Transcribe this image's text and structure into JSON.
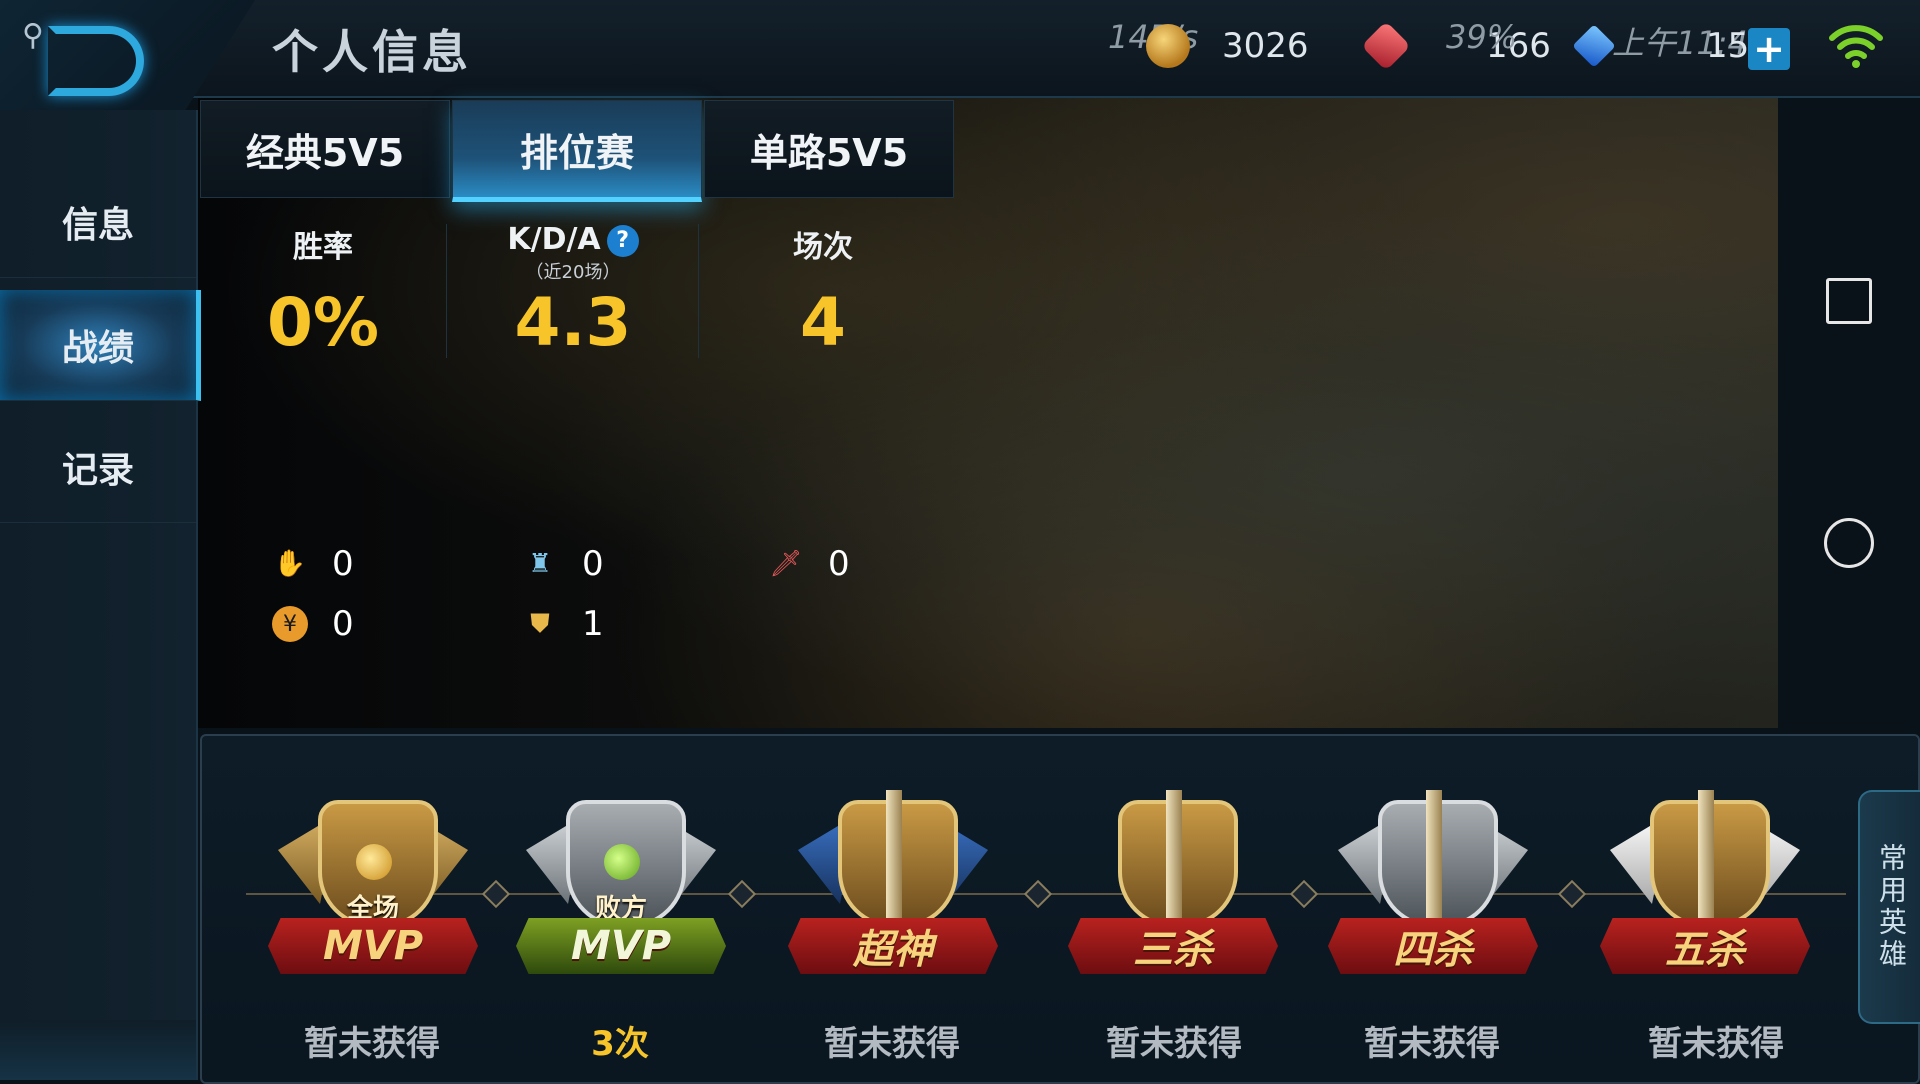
{
  "header": {
    "title": "个人信息",
    "speed": "14B/s",
    "coins": "3026",
    "gems": "166",
    "battery": "39%",
    "time": "上午11:43",
    "diamonds": "15"
  },
  "nav": {
    "items": [
      {
        "label": "信息"
      },
      {
        "label": "战绩"
      },
      {
        "label": "记录"
      }
    ]
  },
  "tabs": [
    "经典5V5",
    "排位赛",
    "单路5V5"
  ],
  "stats": {
    "win_rate": {
      "label": "胜率",
      "value": "0%"
    },
    "kda": {
      "label": "K/D/A",
      "sub": "（近20场）",
      "value": "4.3"
    },
    "games": {
      "label": "场次",
      "value": "4"
    }
  },
  "mini_stats": {
    "hand": "0",
    "tower": "0",
    "blade": "0",
    "gold": "0",
    "shield": "1"
  },
  "achievements": [
    {
      "badge_top": "全场",
      "badge_label": "MVP",
      "status": "暂未获得"
    },
    {
      "badge_top": "败方",
      "badge_label": "MVP",
      "status": "3次"
    },
    {
      "badge_top": "",
      "badge_label": "超神",
      "status": "暂未获得"
    },
    {
      "badge_top": "",
      "badge_label": "三杀",
      "status": "暂未获得"
    },
    {
      "badge_top": "",
      "badge_label": "四杀",
      "status": "暂未获得"
    },
    {
      "badge_top": "",
      "badge_label": "五杀",
      "status": "暂未获得"
    }
  ],
  "side_tab": "常用英雄",
  "icons": {
    "back": "back-arrow-icon",
    "coin": "coin-icon",
    "gem": "gem-icon",
    "diamond": "diamond-icon",
    "plus": "plus-icon",
    "wifi": "wifi-icon",
    "help": "help-icon"
  },
  "colors": {
    "accent": "#2ea9de",
    "value_gold": "#f7c52a"
  }
}
